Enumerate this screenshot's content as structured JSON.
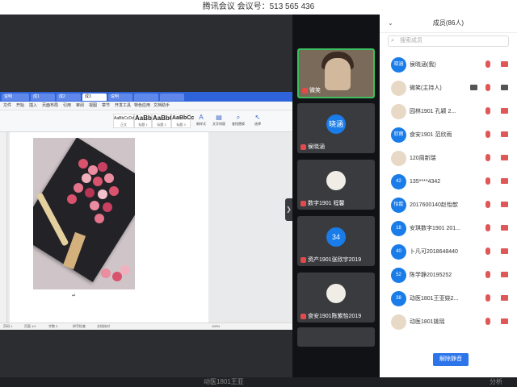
{
  "window": {
    "title": "腾讯会议 会议号：513 565 436"
  },
  "word": {
    "tabs": [
      "说明",
      "成1",
      "成2",
      "成3",
      "说明",
      "",
      ""
    ],
    "menu": [
      "文件",
      "开始",
      "插入",
      "页面布局",
      "引用",
      "审阅",
      "视图",
      "章节",
      "开发工具",
      "特色应用",
      "文档助手"
    ],
    "styles": [
      {
        "preview": "AaBbCcDd",
        "name": "正文"
      },
      {
        "preview": "AaBb",
        "name": "标题 1"
      },
      {
        "preview": "AaBbC",
        "name": "标题 2"
      },
      {
        "preview": "AaBbCc",
        "name": "标题 3"
      }
    ],
    "ribbon_buttons": [
      "新样式",
      "文字排版",
      "查找替换",
      "选择"
    ],
    "status": {
      "page": "页码 1",
      "pages": "页面 1/1",
      "words": "字数 0",
      "spell": "拼写检查",
      "doc": "文档校对",
      "zoom": "100%"
    }
  },
  "video_tiles": [
    {
      "name": "微笑",
      "active": true,
      "avatar": ""
    },
    {
      "name": "侯晓涵",
      "active": false,
      "avatar": "晓涵"
    },
    {
      "name": "数字1901 程馨",
      "active": false,
      "avatar": ""
    },
    {
      "name": "资产1901张欣宇2019",
      "active": false,
      "avatar": "34"
    },
    {
      "name": "食安1901陈紫怡2019",
      "active": false,
      "avatar": ""
    },
    {
      "name": "",
      "active": false,
      "avatar": ""
    }
  ],
  "panel": {
    "title": "成员(86人)",
    "search_placeholder": "搜索成员",
    "mute_all": "解除静音",
    "members": [
      {
        "avatar": "晓涵",
        "name": "侯晓涵(我)",
        "screen": false
      },
      {
        "avatar": "",
        "name": "微笑(主持人)",
        "screen": true
      },
      {
        "avatar": "",
        "name": "园林1901  孔颖  2...",
        "screen": false
      },
      {
        "avatar": "欣雨",
        "name": "食安1901  范欣雨",
        "screen": false
      },
      {
        "avatar": "",
        "name": "120周新瑞",
        "screen": false
      },
      {
        "avatar": "42",
        "name": "135****4342",
        "screen": false
      },
      {
        "avatar": "怡歆",
        "name": "2017600140赵怡歆",
        "screen": false
      },
      {
        "avatar": "18",
        "name": "安琪数字1901 201...",
        "screen": false
      },
      {
        "avatar": "40",
        "name": "卜凡可2018648440",
        "screen": false
      },
      {
        "avatar": "52",
        "name": "陈学静20195252",
        "screen": false
      },
      {
        "avatar": "38",
        "name": "动医1801王亚娆2...",
        "screen": false
      },
      {
        "avatar": "",
        "name": "动医1801姚瑶",
        "screen": false
      }
    ]
  },
  "bottom": {
    "name": "动医1801王亚",
    "analyze": "分析"
  },
  "colors": {
    "accent": "#2b74ea",
    "muted_red": "#e05757",
    "active_green": "#3bbf5f"
  }
}
